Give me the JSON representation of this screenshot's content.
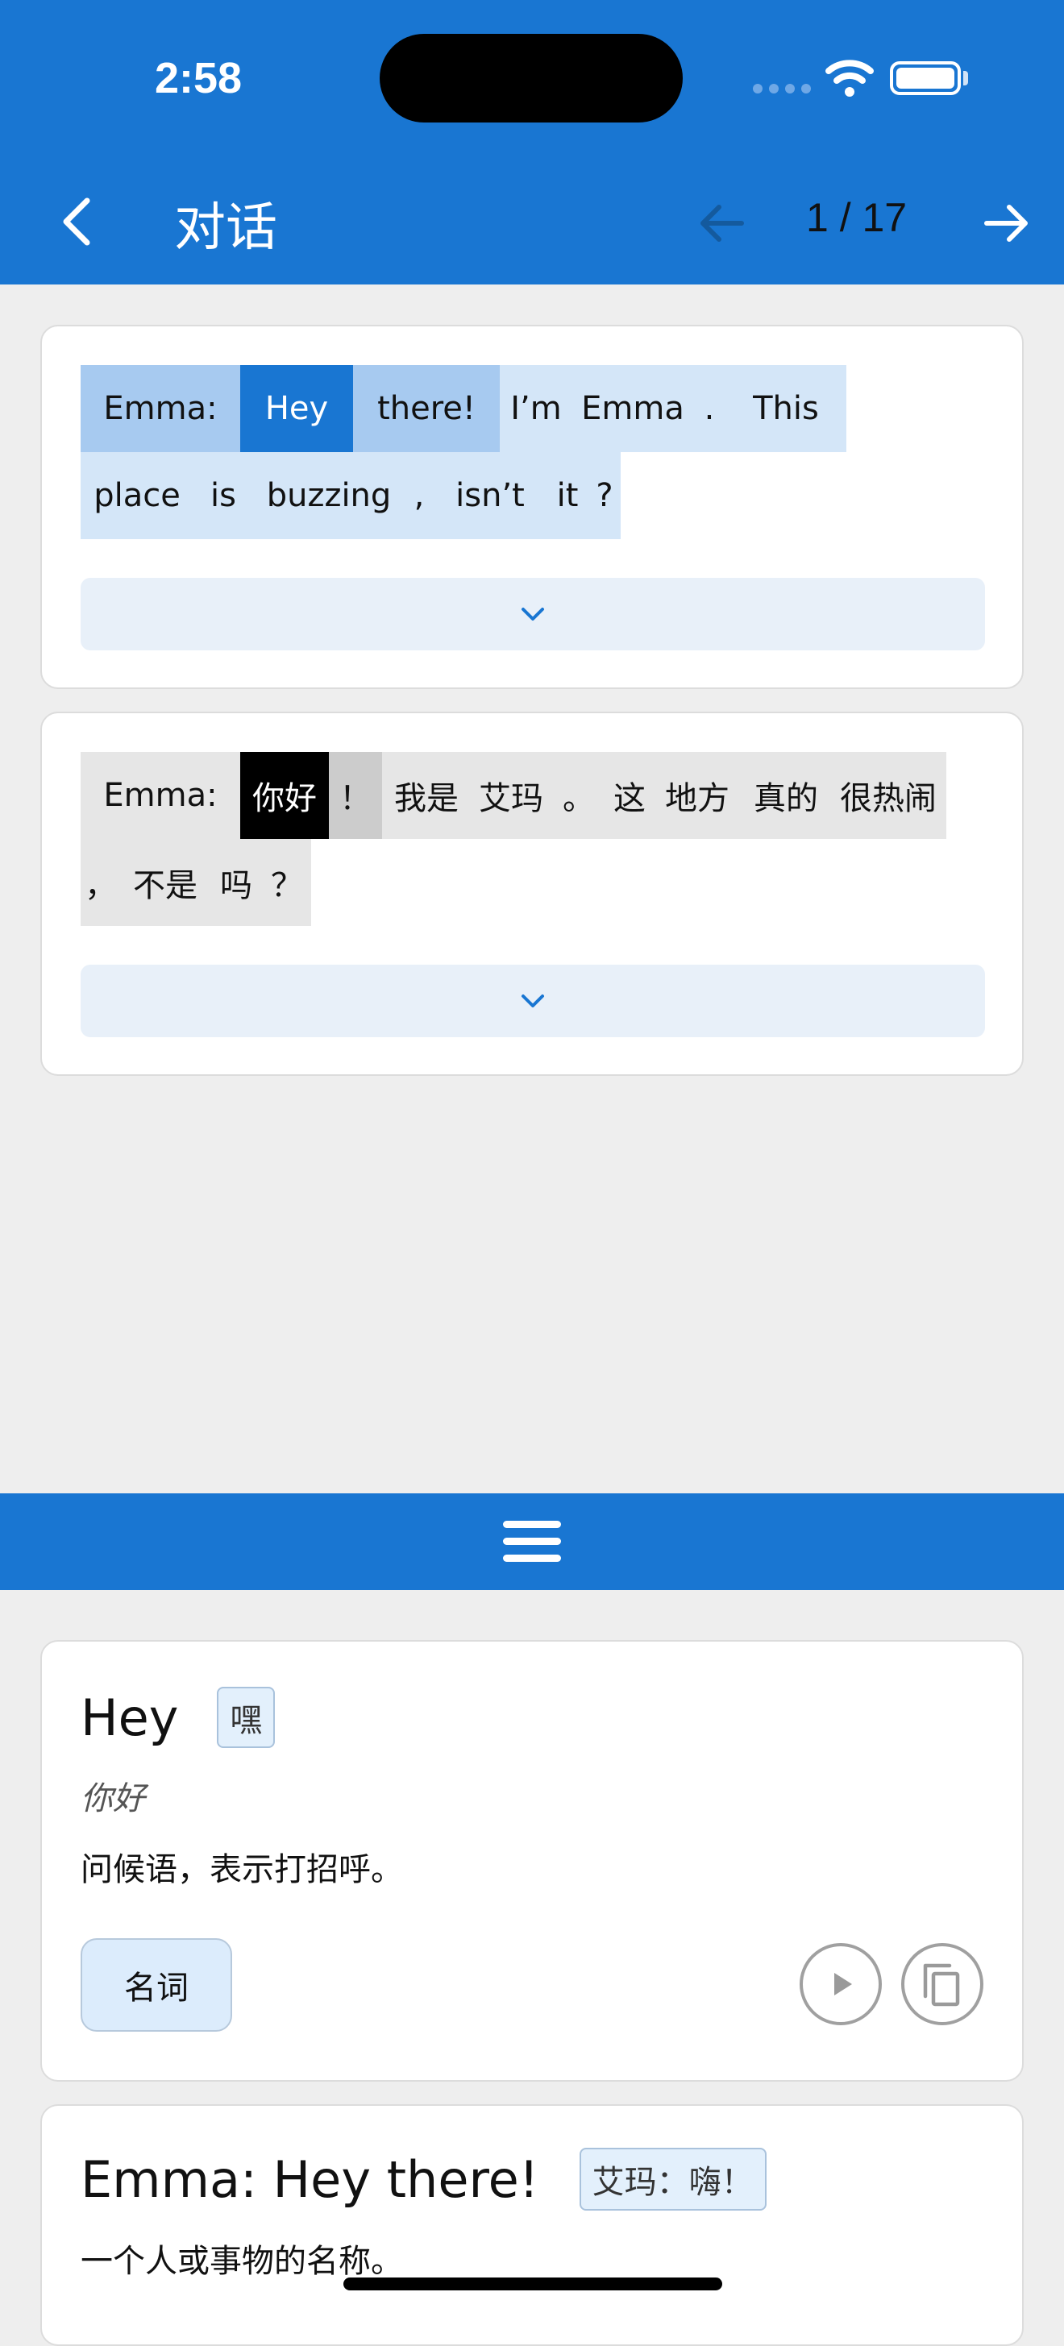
{
  "status": {
    "time": "2:58"
  },
  "header": {
    "title": "对话",
    "page_counter": "1 / 17"
  },
  "colors": {
    "primary": "#1976d2",
    "selected_zh": "#000000",
    "background": "#eeeeee"
  },
  "icons": {
    "back": "chevron-left-icon",
    "prev": "arrow-left-icon",
    "next": "arrow-right-icon",
    "expand": "chevron-down-icon",
    "menu": "hamburger-menu-icon",
    "play": "play-icon",
    "copy": "copy-icon"
  },
  "sentence_en": {
    "lines": [
      [
        {
          "t": "Emma:",
          "state": "hl"
        },
        {
          "t": "Hey",
          "state": "sel"
        },
        {
          "t": "there!",
          "state": "hl"
        },
        {
          "t": "I’m",
          "state": ""
        },
        {
          "t": "Emma",
          "state": ""
        },
        {
          "t": ".",
          "state": ""
        },
        {
          "t": "This",
          "state": ""
        }
      ],
      [
        {
          "t": "place",
          "state": ""
        },
        {
          "t": "is",
          "state": ""
        },
        {
          "t": "buzzing",
          "state": ""
        },
        {
          "t": ",",
          "state": ""
        },
        {
          "t": "isn’t",
          "state": ""
        },
        {
          "t": "it",
          "state": ""
        },
        {
          "t": "?",
          "state": ""
        }
      ]
    ]
  },
  "sentence_zh": {
    "lines": [
      [
        {
          "t": "Emma:",
          "state": ""
        },
        {
          "t": "你好",
          "state": "sel"
        },
        {
          "t": "！",
          "state": "hl"
        },
        {
          "t": "我是",
          "state": ""
        },
        {
          "t": "艾玛",
          "state": ""
        },
        {
          "t": "。",
          "state": ""
        },
        {
          "t": "这",
          "state": ""
        },
        {
          "t": "地方",
          "state": ""
        },
        {
          "t": "真的",
          "state": ""
        },
        {
          "t": "很热闹",
          "state": ""
        }
      ],
      [
        {
          "t": "，",
          "state": ""
        },
        {
          "t": "不是",
          "state": ""
        },
        {
          "t": "吗",
          "state": ""
        },
        {
          "t": "？",
          "state": ""
        }
      ]
    ]
  },
  "word_card": {
    "term": "Hey",
    "badge": "嘿",
    "translation": "你好",
    "definition": "问候语，表示打招呼。",
    "pos": "名词"
  },
  "sentence_card": {
    "text": "Emma: Hey there!",
    "badge": "艾玛：嗨！",
    "definition": "一个人或事物的名称。"
  }
}
